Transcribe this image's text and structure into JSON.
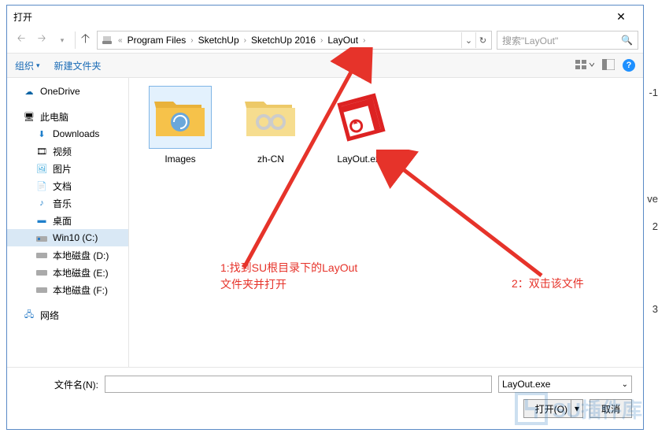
{
  "window": {
    "title": "打开"
  },
  "breadcrumb": {
    "items": [
      "Program Files",
      "SketchUp",
      "SketchUp 2016",
      "LayOut"
    ]
  },
  "search": {
    "placeholder": "搜索\"LayOut\""
  },
  "toolbar": {
    "organize": "组织",
    "new_folder": "新建文件夹"
  },
  "sidebar": {
    "onedrive": "OneDrive",
    "thispc": "此电脑",
    "downloads": "Downloads",
    "videos": "视频",
    "pictures": "图片",
    "documents": "文档",
    "music": "音乐",
    "desktop": "桌面",
    "win10": "Win10 (C:)",
    "diskD": "本地磁盘 (D:)",
    "diskE": "本地磁盘 (E:)",
    "diskF": "本地磁盘 (F:)",
    "network": "网络"
  },
  "files": {
    "images": "Images",
    "zhcn": "zh-CN",
    "layoutexe": "LayOut.exe"
  },
  "bottom": {
    "filename_label": "文件名(N):",
    "filter": "LayOut.exe",
    "open": "打开(O)",
    "cancel": "取消"
  },
  "annotations": {
    "a1": "1:找到SU根目录下的LayOut文件夹并打开",
    "a2": "2：双击该文件"
  },
  "watermark": "SU插件库",
  "rightedge": {
    "t1": "-1",
    "t2": "ve",
    "t3": "2",
    "t4": "3"
  }
}
